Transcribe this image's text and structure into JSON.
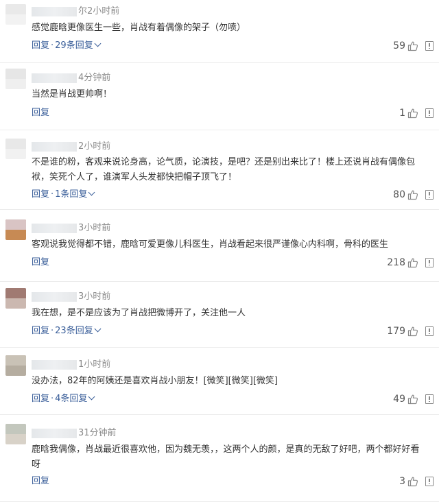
{
  "reply_label": "回复",
  "comments": [
    {
      "time": "2小时前",
      "time_prefix": "尔",
      "text": "感觉鹿晗更像医生一些，肖战有着偶像的架子（勿喷）",
      "replies": "29条回复",
      "likes": "59",
      "avatar_colors": [
        "#e9e9e9",
        "#f2f2f2"
      ]
    },
    {
      "time": "4分钟前",
      "time_prefix": "",
      "text": "当然是肖战更帅啊！",
      "replies": "",
      "likes": "1",
      "avatar_colors": [
        "#e6e6e6",
        "#efefef"
      ]
    },
    {
      "time": "2小时前",
      "time_prefix": "",
      "text": "不是谁的粉，客观来说论身高，论气质，论演技，是吧？还是别出来比了！楼上还说肖战有偶像包袱，笑死个人了，谁演军人头发都快把帽子顶飞了！",
      "replies": "1条回复",
      "likes": "80",
      "avatar_colors": [
        "#e8e8e8",
        "#f1f1f1"
      ]
    },
    {
      "time": "3小时前",
      "time_prefix": "",
      "text": "客观说我觉得都不错，鹿晗可爱更像儿科医生，肖战看起来很严谨像心内科啊，骨科的医生",
      "replies": "",
      "likes": "218",
      "avatar_colors": [
        "#d9c4c4",
        "#c78a54"
      ]
    },
    {
      "time": "3小时前",
      "time_prefix": "",
      "text": "我在想，是不是应该为了肖战把微博开了，关注他一人",
      "replies": "23条回复",
      "likes": "179",
      "avatar_colors": [
        "#a07a72",
        "#cbb8b0"
      ]
    },
    {
      "time": "1小时前",
      "time_prefix": "",
      "text": "没办法，82年的阿姨还是喜欢肖战小朋友！[微笑][微笑][微笑]",
      "replies": "4条回复",
      "likes": "49",
      "avatar_colors": [
        "#c9c2b6",
        "#b5ada0"
      ]
    },
    {
      "time": "31分钟前",
      "time_prefix": "",
      "text": "鹿晗我偶像，肖战最近很喜欢他，因为魏无羡，，这两个人的颜，是真的无敌了好吧，两个都好好看呀",
      "replies": "",
      "likes": "3",
      "avatar_colors": [
        "#c3c7bd",
        "#d8d2c8"
      ]
    }
  ]
}
